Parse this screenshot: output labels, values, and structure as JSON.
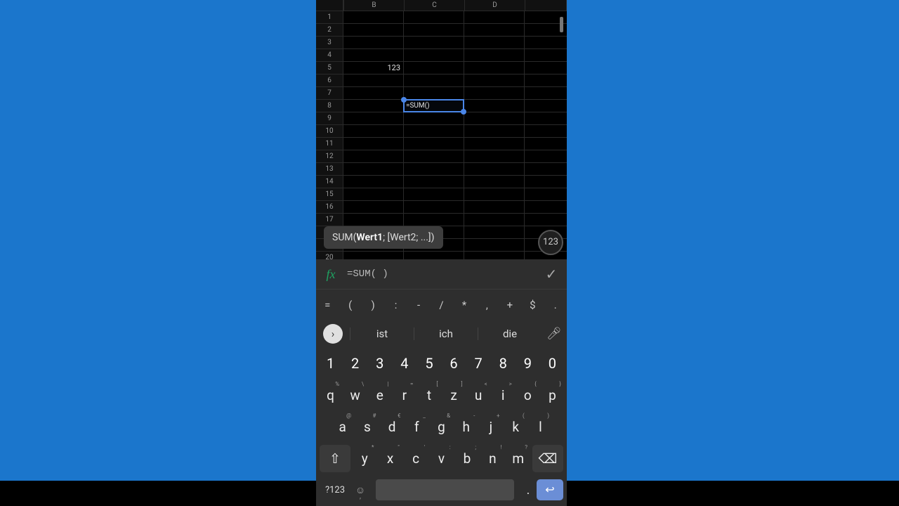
{
  "spreadsheet": {
    "columns": [
      "B",
      "C",
      "D"
    ],
    "row_count": 20,
    "cell_b5": "123",
    "selected": {
      "ref": "C8",
      "value": "=SUM()"
    }
  },
  "func_tooltip": {
    "prefix": "SUM(",
    "emph": "Wert1",
    "rest": "; [Wert2; ...])"
  },
  "numpad_toggle": "123",
  "formula_bar": {
    "fx": "fx",
    "value": "=SUM( )"
  },
  "symbol_row": [
    "=",
    "(",
    ")",
    ":",
    "-",
    "/",
    "*",
    ",",
    "+",
    "$",
    "."
  ],
  "keyboard": {
    "suggestions": [
      "ist",
      "ich",
      "die"
    ],
    "row_num": [
      "1",
      "2",
      "3",
      "4",
      "5",
      "6",
      "7",
      "8",
      "9",
      "0"
    ],
    "row1": [
      {
        "k": "q",
        "s": "%"
      },
      {
        "k": "w",
        "s": "\\"
      },
      {
        "k": "e",
        "s": "|"
      },
      {
        "k": "r",
        "s": "="
      },
      {
        "k": "t",
        "s": "["
      },
      {
        "k": "z",
        "s": "]"
      },
      {
        "k": "u",
        "s": "<"
      },
      {
        "k": "i",
        "s": ">"
      },
      {
        "k": "o",
        "s": "{"
      },
      {
        "k": "p",
        "s": "}"
      }
    ],
    "row2": [
      {
        "k": "a",
        "s": "@"
      },
      {
        "k": "s",
        "s": "#"
      },
      {
        "k": "d",
        "s": "€"
      },
      {
        "k": "f",
        "s": "_"
      },
      {
        "k": "g",
        "s": "&"
      },
      {
        "k": "h",
        "s": "-"
      },
      {
        "k": "j",
        "s": "+"
      },
      {
        "k": "k",
        "s": "("
      },
      {
        "k": "l",
        "s": ")"
      }
    ],
    "row3": [
      {
        "k": "y",
        "s": "*"
      },
      {
        "k": "x",
        "s": "\""
      },
      {
        "k": "c",
        "s": "'"
      },
      {
        "k": "v",
        "s": ":"
      },
      {
        "k": "b",
        "s": ";"
      },
      {
        "k": "n",
        "s": "!"
      },
      {
        "k": "m",
        "s": "?"
      }
    ],
    "mode": "?123",
    "period": "."
  }
}
